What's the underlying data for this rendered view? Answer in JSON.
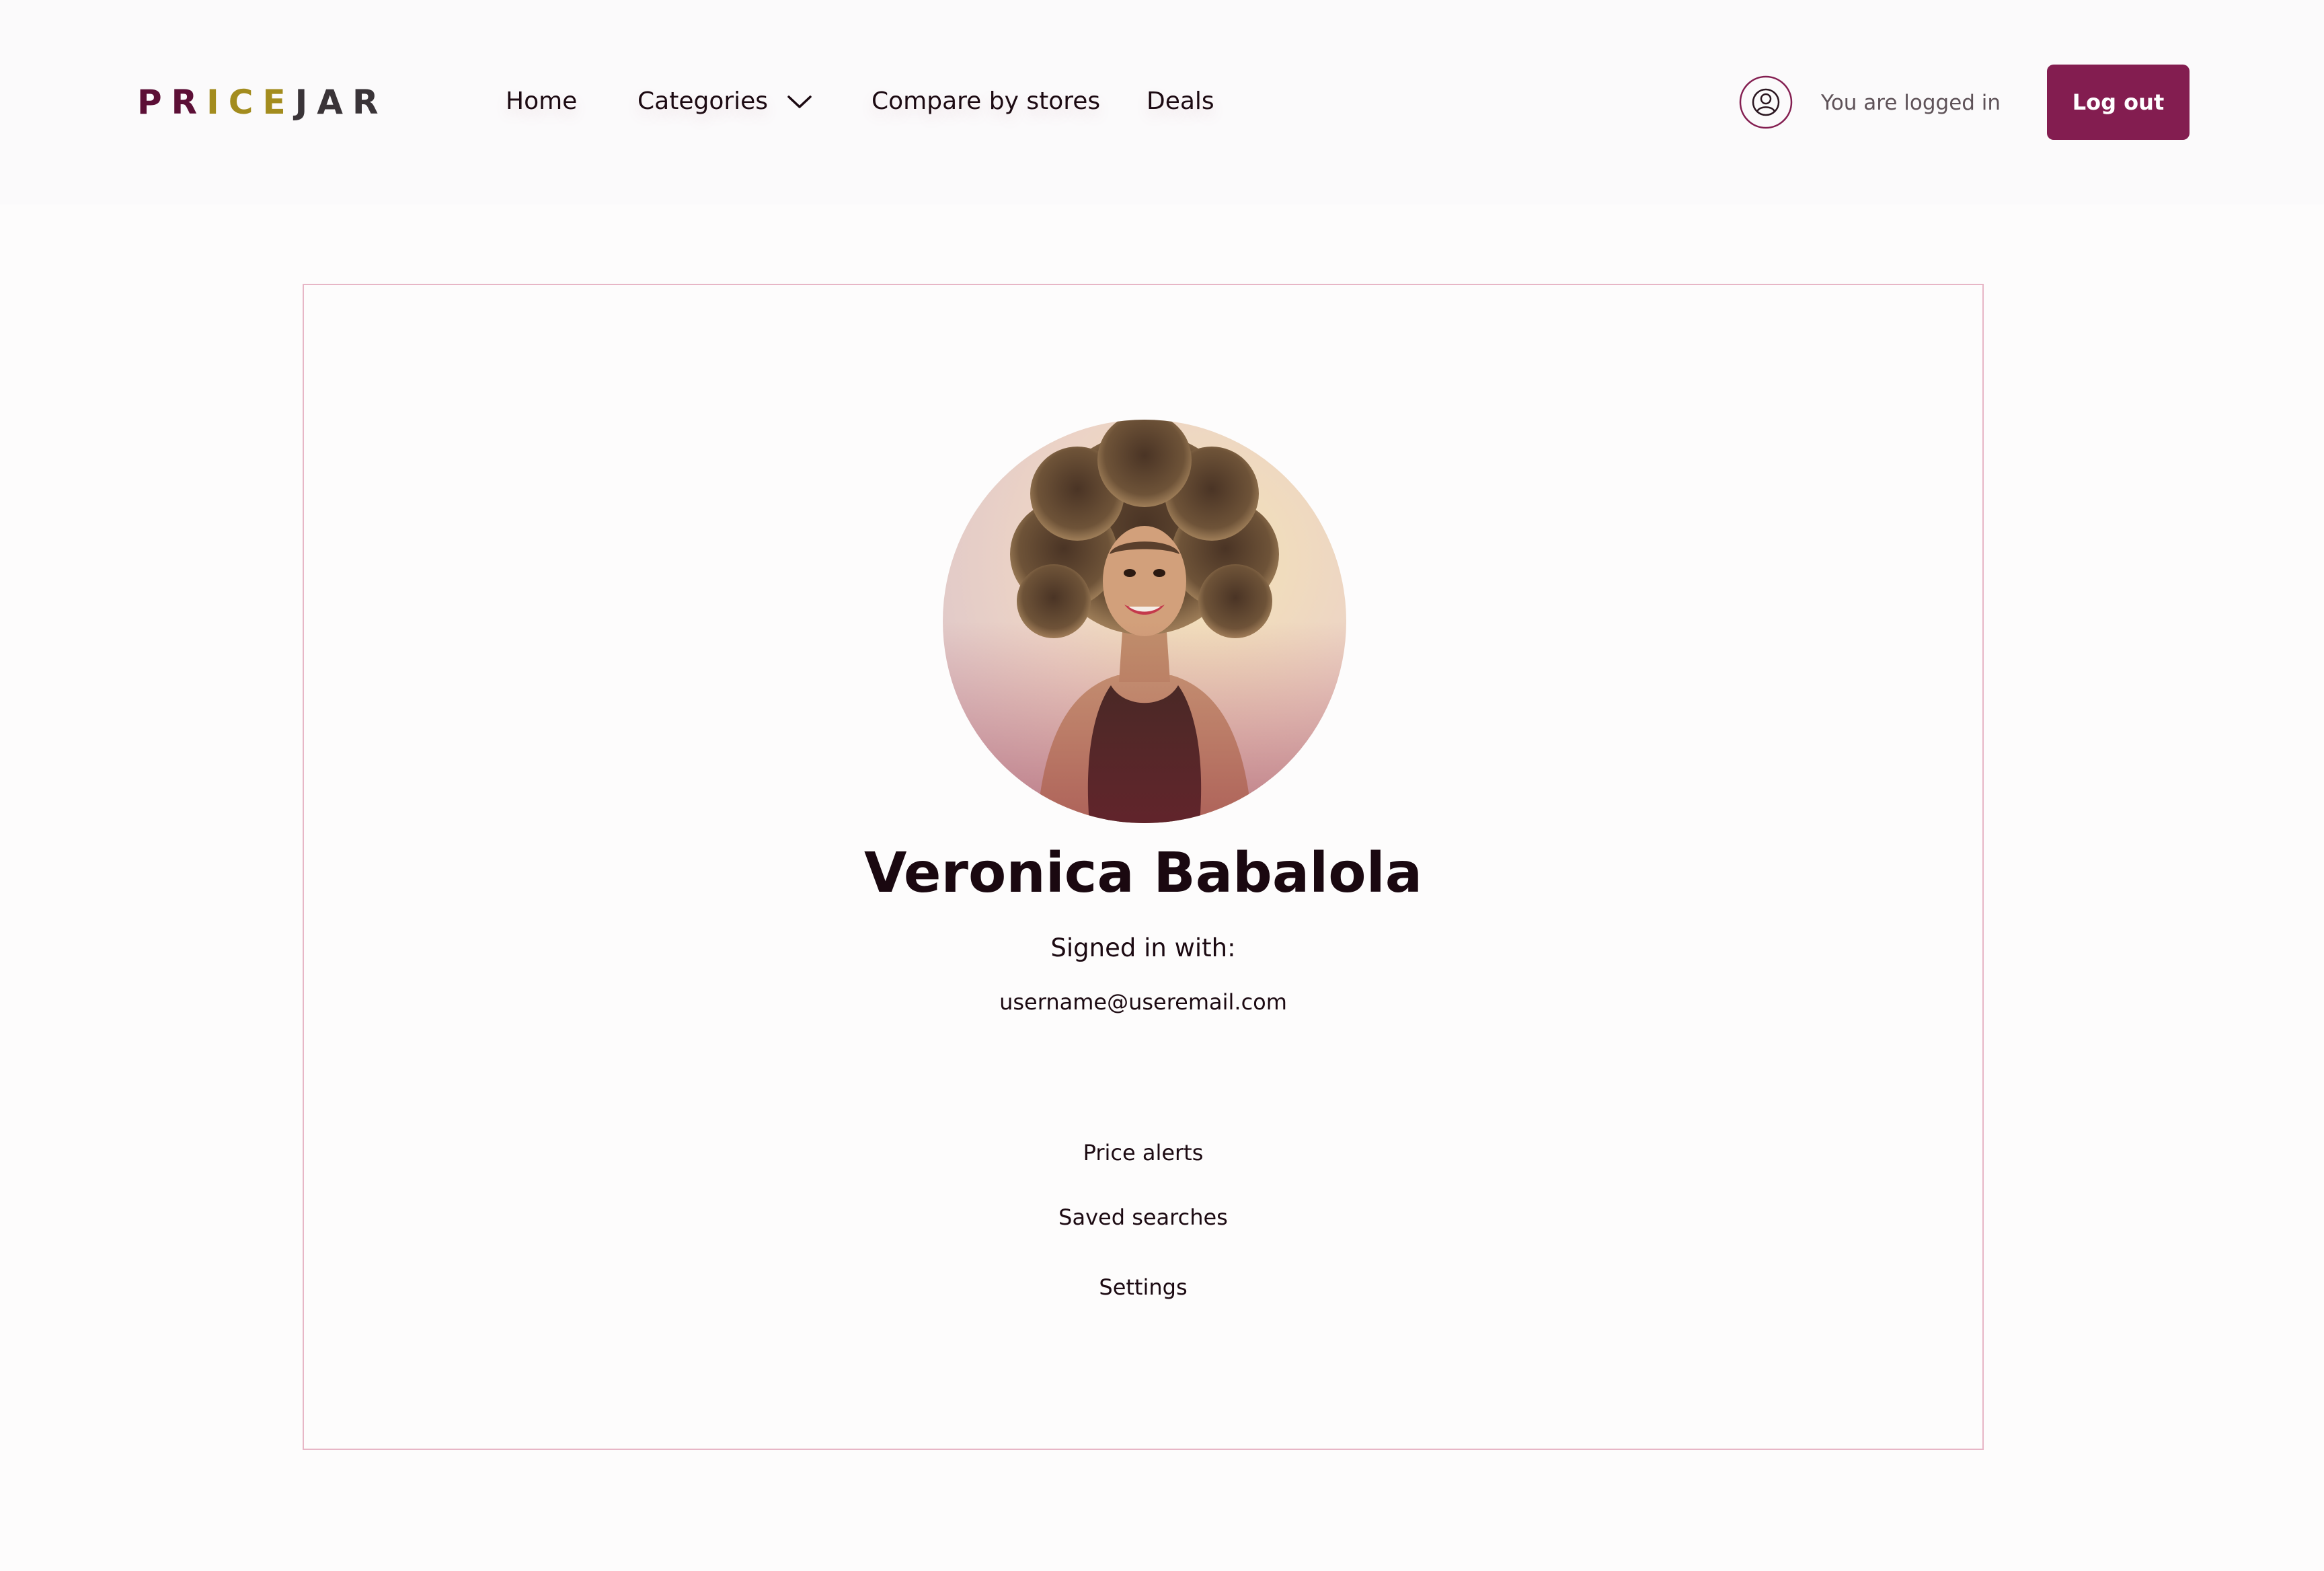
{
  "header": {
    "logo": {
      "letters": [
        {
          "char": "P",
          "color": "#5c0f36"
        },
        {
          "char": "R",
          "color": "#5c0f36"
        },
        {
          "char": "I",
          "color": "#a38c1e"
        },
        {
          "char": "C",
          "color": "#a38c1e"
        },
        {
          "char": "E",
          "color": "#a38c1e"
        },
        {
          "char": "J",
          "color": "#3a3438"
        },
        {
          "char": "A",
          "color": "#3a3438"
        },
        {
          "char": "R",
          "color": "#3a3438"
        }
      ]
    },
    "nav": {
      "home": "Home",
      "categories": "Categories",
      "compare": "Compare by stores",
      "deals": "Deals"
    },
    "status_text": "You are logged in",
    "logout_label": "Log out"
  },
  "profile": {
    "name": "Veronica Babalola",
    "signed_in_label": "Signed in with:",
    "email": "username@useremail.com",
    "menu": {
      "price_alerts": "Price alerts",
      "saved_searches": "Saved searches",
      "settings": "Settings"
    }
  },
  "colors": {
    "accent": "#831d50",
    "card_border": "#e7b6c6",
    "text": "#1c0a12"
  },
  "icons": {
    "account": "user-circle-icon",
    "dropdown": "chevron-down-icon"
  }
}
